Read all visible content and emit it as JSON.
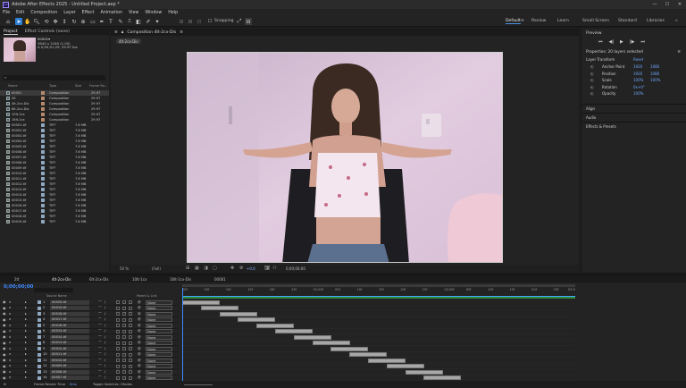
{
  "titlebar": {
    "title": "Adobe After Effects 2025 - Untitled Project.aep *"
  },
  "menu": [
    "File",
    "Edit",
    "Composition",
    "Layer",
    "Effect",
    "Animation",
    "View",
    "Window",
    "Help"
  ],
  "toolbar": {
    "snapping": "Snapping",
    "workspaces": [
      "Default",
      "Review",
      "Learn",
      "Small Screen",
      "Standard",
      "Libraries"
    ]
  },
  "project": {
    "tabs": [
      "Project",
      "Effect Controls (none)"
    ],
    "selected_name": "00001▾",
    "info": [
      "3840 x 2160 (1.00)",
      "Δ 0;00;01;29, 29.97 fps"
    ],
    "columns": [
      "Name",
      "Type",
      "Size",
      "Frame Ra..."
    ],
    "items": [
      {
        "name": "00001",
        "type": "Composition",
        "size": "",
        "fps": "29.97",
        "sel": true
      },
      {
        "name": "2lt",
        "type": "Composition",
        "size": "",
        "fps": "29.97"
      },
      {
        "name": "4lt-2cx-Dis",
        "type": "Composition",
        "size": "",
        "fps": "29.97"
      },
      {
        "name": "6lt-2cx-Dis",
        "type": "Composition",
        "size": "",
        "fps": "29.97"
      },
      {
        "name": "10lt-1cx",
        "type": "Composition",
        "size": "",
        "fps": "29.97"
      },
      {
        "name": "16lt-1cx",
        "type": "Composition",
        "size": "",
        "fps": "29.97"
      },
      {
        "name": "00001.tif",
        "type": "TIFF",
        "size": "7.6 MB",
        "fps": ""
      },
      {
        "name": "00002.tif",
        "type": "TIFF",
        "size": "7.6 MB",
        "fps": ""
      },
      {
        "name": "00003.tif",
        "type": "TIFF",
        "size": "7.6 MB",
        "fps": ""
      },
      {
        "name": "00004.tif",
        "type": "TIFF",
        "size": "7.6 MB",
        "fps": ""
      },
      {
        "name": "00005.tif",
        "type": "TIFF",
        "size": "7.6 MB",
        "fps": ""
      },
      {
        "name": "00006.tif",
        "type": "TIFF",
        "size": "7.6 MB",
        "fps": ""
      },
      {
        "name": "00007.tif",
        "type": "TIFF",
        "size": "7.6 MB",
        "fps": ""
      },
      {
        "name": "00008.tif",
        "type": "TIFF",
        "size": "7.6 MB",
        "fps": ""
      },
      {
        "name": "00009.tif",
        "type": "TIFF",
        "size": "7.6 MB",
        "fps": ""
      },
      {
        "name": "00010.tif",
        "type": "TIFF",
        "size": "7.6 MB",
        "fps": ""
      },
      {
        "name": "00011.tif",
        "type": "TIFF",
        "size": "7.6 MB",
        "fps": ""
      },
      {
        "name": "00012.tif",
        "type": "TIFF",
        "size": "7.6 MB",
        "fps": ""
      },
      {
        "name": "00013.tif",
        "type": "TIFF",
        "size": "7.6 MB",
        "fps": ""
      },
      {
        "name": "00014.tif",
        "type": "TIFF",
        "size": "7.6 MB",
        "fps": ""
      },
      {
        "name": "00015.tif",
        "type": "TIFF",
        "size": "7.6 MB",
        "fps": ""
      },
      {
        "name": "00016.tif",
        "type": "TIFF",
        "size": "7.6 MB",
        "fps": ""
      },
      {
        "name": "00017.tif",
        "type": "TIFF",
        "size": "7.6 MB",
        "fps": ""
      },
      {
        "name": "00018.tif",
        "type": "TIFF",
        "size": "7.6 MB",
        "fps": ""
      },
      {
        "name": "00019.tif",
        "type": "TIFF",
        "size": "7.6 MB",
        "fps": ""
      }
    ],
    "footer_bpc": "8 bpc"
  },
  "comp": {
    "tab": "Composition 4lt-2cx-Dis",
    "crumb": "4lt-2cx-Dis",
    "zoom": "50 %",
    "quality": "(Full)",
    "exposure": "+0.0",
    "timecode": "0;00;00;00"
  },
  "right": {
    "preview": "Preview",
    "properties": "Properties: 20 layers selected",
    "layer_transform": "Layer Transform",
    "reset": "Reset",
    "rows": [
      {
        "label": "Anchor Point",
        "v1": "1920",
        "v2": "1080"
      },
      {
        "label": "Position",
        "v1": "1920",
        "v2": "1080"
      },
      {
        "label": "Scale",
        "v1": "100%",
        "v2": "100%"
      },
      {
        "label": "Rotation",
        "v1": "0x+0°",
        "v2": ""
      },
      {
        "label": "Opacity",
        "v1": "100%",
        "v2": ""
      }
    ],
    "sections": [
      "Align",
      "Audio",
      "Effects & Presets"
    ]
  },
  "timeline": {
    "tabs": [
      "2lt",
      "4lt-2cx-Dis",
      "6lt-2cx-Dis",
      "10lt-1cx",
      "16lt-1cx-Dis",
      "00001"
    ],
    "timecode": "0;00;00;00",
    "col_source": "Source Name",
    "col_parent": "Parent & Link",
    "ruler": [
      "00f",
      "05f",
      "10f",
      "15f",
      "20f",
      "25f",
      "01:00f",
      "05f",
      "10f",
      "15f",
      "20f",
      "25f",
      "02:00f",
      "05f",
      "10f",
      "15f",
      "20f",
      "25f",
      "03:0"
    ],
    "layers": [
      {
        "num": "1",
        "name": "00020.tif",
        "parent": "None"
      },
      {
        "num": "2",
        "name": "00019.tif",
        "parent": "None"
      },
      {
        "num": "3",
        "name": "00018.tif",
        "parent": "None"
      },
      {
        "num": "4",
        "name": "00017.tif",
        "parent": "None"
      },
      {
        "num": "5",
        "name": "00016.tif",
        "parent": "None"
      },
      {
        "num": "6",
        "name": "00015.tif",
        "parent": "None"
      },
      {
        "num": "7",
        "name": "00014.tif",
        "parent": "None"
      },
      {
        "num": "8",
        "name": "00013.tif",
        "parent": "None"
      },
      {
        "num": "9",
        "name": "00012.tif",
        "parent": "None"
      },
      {
        "num": "10",
        "name": "00011.tif",
        "parent": "None"
      },
      {
        "num": "11",
        "name": "00010.tif",
        "parent": "None"
      },
      {
        "num": "12",
        "name": "00009.tif",
        "parent": "None"
      },
      {
        "num": "13",
        "name": "00008.tif",
        "parent": "None"
      },
      {
        "num": "14",
        "name": "00007.tif",
        "parent": "None"
      }
    ],
    "footer_left": "Frame Render Time",
    "footer_left_val": "0ms",
    "footer_mid": "Toggle Switches / Modes"
  },
  "colors": {
    "accent": "#2d7fd4",
    "timecode": "#3d8cff",
    "label_tiff": "#8ea7bf",
    "label_comp": "#b48a6a"
  }
}
